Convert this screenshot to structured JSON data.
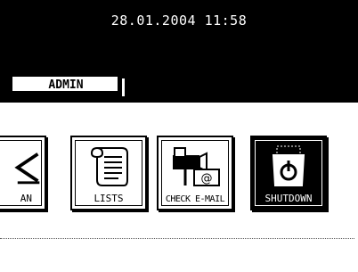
{
  "header": {
    "datetime": "28.01.2004 11:58",
    "tab_label": "ADMIN"
  },
  "buttons": [
    {
      "label": "AN",
      "icon": "scan-icon"
    },
    {
      "label": "LISTS",
      "icon": "lists-icon"
    },
    {
      "label": "CHECK E-MAIL",
      "icon": "check-email-icon"
    },
    {
      "label": "SHUTDOWN",
      "icon": "shutdown-icon"
    }
  ],
  "colors": {
    "background": "#ffffff",
    "bar": "#000000",
    "selected_button": "#000000"
  }
}
